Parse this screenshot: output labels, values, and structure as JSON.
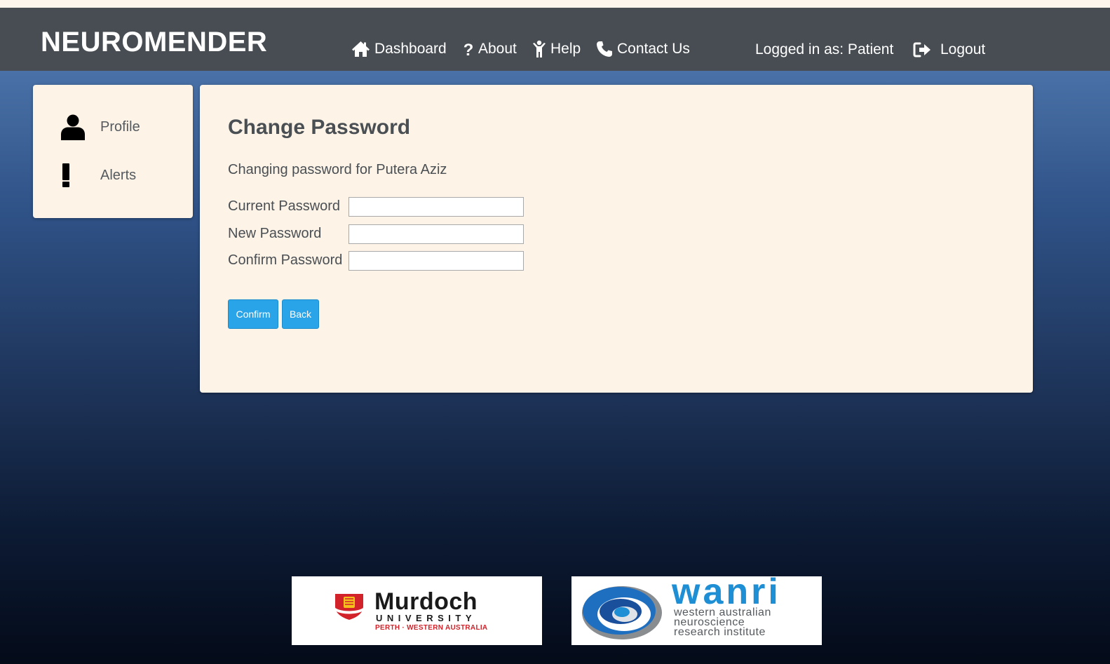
{
  "header": {
    "brand": "NEUROMENDER",
    "nav": [
      {
        "label": "Dashboard",
        "icon": "home-icon"
      },
      {
        "label": "About",
        "icon": "question-icon"
      },
      {
        "label": "Help",
        "icon": "person-help-icon"
      },
      {
        "label": "Contact Us",
        "icon": "phone-icon"
      }
    ],
    "logged_in_text": "Logged in as: Patient",
    "logout_label": "Logout"
  },
  "sidebar": {
    "items": [
      {
        "label": "Profile",
        "icon": "user-icon"
      },
      {
        "label": "Alerts",
        "icon": "exclamation-icon"
      }
    ]
  },
  "main": {
    "title": "Change Password",
    "subtitle": "Changing password for Putera Aziz",
    "fields": [
      {
        "label": "Current Password",
        "value": "",
        "placeholder": ""
      },
      {
        "label": "New Password",
        "value": "",
        "placeholder": ""
      },
      {
        "label": "Confirm Password",
        "value": "",
        "placeholder": ""
      }
    ],
    "confirm_label": "Confirm",
    "back_label": "Back"
  },
  "footer": {
    "murdoch": {
      "name": "Murdoch",
      "subtitle": "UNIVERSITY",
      "location": "PERTH · WESTERN AUSTRALIA"
    },
    "wanri": {
      "name": "wanri",
      "line1": "western australian",
      "line2": "neuroscience",
      "line3": "research institute"
    }
  },
  "colors": {
    "navbar": "#474d52",
    "panel": "#fdf3e7",
    "button": "#2aa4e8",
    "murdoch_red": "#d2232a",
    "wanri_blue": "#1e8fd4"
  }
}
